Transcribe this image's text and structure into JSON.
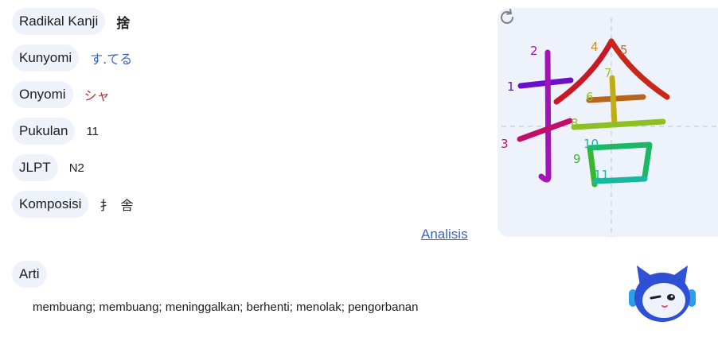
{
  "fields": [
    {
      "label": "Radikal Kanji",
      "value": "捨",
      "kind": "kanji"
    },
    {
      "label": "Kunyomi",
      "value": "す.てる",
      "kind": "kun"
    },
    {
      "label": "Onyomi",
      "value": "シャ",
      "kind": "on"
    },
    {
      "label": "Pukulan",
      "value": "11",
      "kind": "plain"
    },
    {
      "label": "JLPT",
      "value": "N2",
      "kind": "plain"
    }
  ],
  "komposisi": {
    "label": "Komposisi",
    "parts": [
      "扌",
      "舎"
    ]
  },
  "analisis_link": "Analisis",
  "arti": {
    "label": "Arti",
    "text": "membuang; membuang; meninggalkan; berhenti; menolak; pengorbanan"
  },
  "stroke_numbers": [
    "1",
    "2",
    "3",
    "4",
    "5",
    "6",
    "7",
    "8",
    "9",
    "10",
    "11"
  ],
  "icons": {
    "replay": "refresh-icon",
    "mascot": "robot-cat-mascot-icon"
  }
}
